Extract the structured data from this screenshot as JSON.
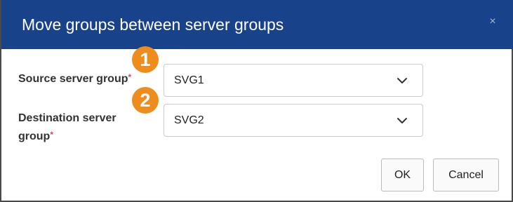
{
  "dialog": {
    "title": "Move groups between server groups",
    "close_symbol": "×"
  },
  "fields": {
    "source": {
      "label": "Source server group",
      "required_mark": "*",
      "value": "SVG1",
      "badge": "1"
    },
    "destination": {
      "label_line1": "Destination server",
      "label_line2": "group",
      "required_mark": "*",
      "value": "SVG2",
      "badge": "2"
    }
  },
  "buttons": {
    "ok_label": "OK",
    "cancel_label": "Cancel"
  },
  "colors": {
    "titlebar": "#18428a",
    "badge": "#ee8c1e",
    "required": "#d04a5a"
  },
  "icons": {
    "close": "close-icon",
    "dropdown": "chevron-down-icon"
  }
}
